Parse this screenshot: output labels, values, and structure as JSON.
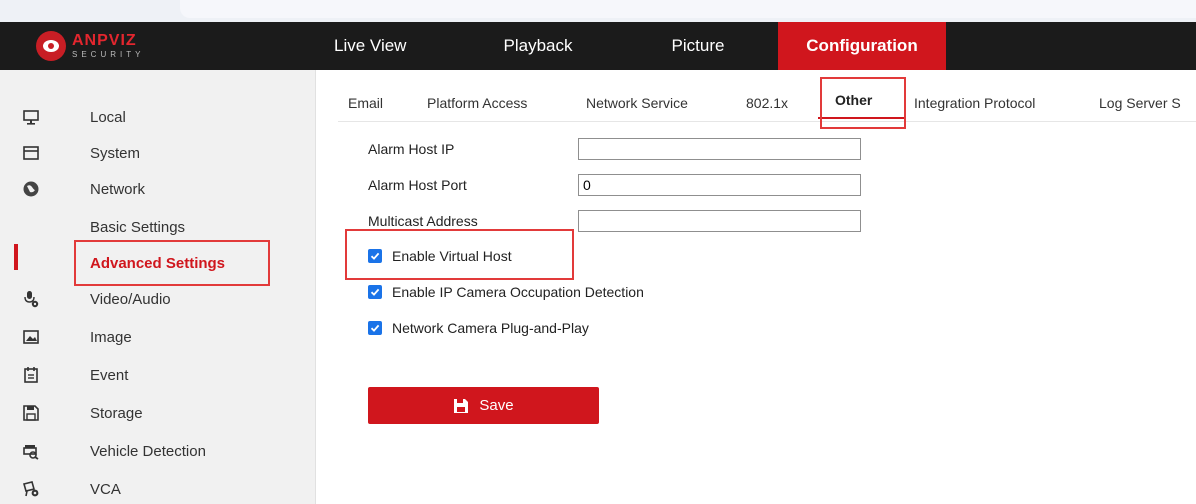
{
  "brand": {
    "name": "ANPVIZ",
    "tagline": "SECURITY",
    "accent": "#d0161d"
  },
  "nav": {
    "items": [
      {
        "label": "Live View"
      },
      {
        "label": "Playback"
      },
      {
        "label": "Picture"
      },
      {
        "label": "Configuration",
        "active": true
      }
    ]
  },
  "sidebar": {
    "items": [
      {
        "label": "Local",
        "icon": "monitor-icon"
      },
      {
        "label": "System",
        "icon": "system-icon"
      },
      {
        "label": "Network",
        "icon": "globe-icon"
      },
      {
        "label": "Basic Settings"
      },
      {
        "label": "Advanced Settings",
        "active": true
      },
      {
        "label": "Video/Audio",
        "icon": "microphone-icon"
      },
      {
        "label": "Image",
        "icon": "image-icon"
      },
      {
        "label": "Event",
        "icon": "event-icon"
      },
      {
        "label": "Storage",
        "icon": "floppy-disk-icon"
      },
      {
        "label": "Vehicle Detection",
        "icon": "vehicle-icon"
      },
      {
        "label": "VCA",
        "icon": "vca-icon"
      }
    ]
  },
  "tabs": [
    {
      "label": "Email"
    },
    {
      "label": "Platform Access"
    },
    {
      "label": "Network Service"
    },
    {
      "label": "802.1x"
    },
    {
      "label": "Other",
      "active": true
    },
    {
      "label": "Integration Protocol"
    },
    {
      "label": "Log Server S"
    }
  ],
  "form": {
    "fields": [
      {
        "label": "Alarm Host IP",
        "value": ""
      },
      {
        "label": "Alarm Host Port",
        "value": "0"
      },
      {
        "label": "Multicast Address",
        "value": ""
      }
    ],
    "checkboxes": [
      {
        "label": "Enable Virtual Host",
        "checked": true
      },
      {
        "label": "Enable IP Camera Occupation Detection",
        "checked": true
      },
      {
        "label": "Network Camera Plug-and-Play",
        "checked": true
      }
    ],
    "save_label": "Save"
  }
}
